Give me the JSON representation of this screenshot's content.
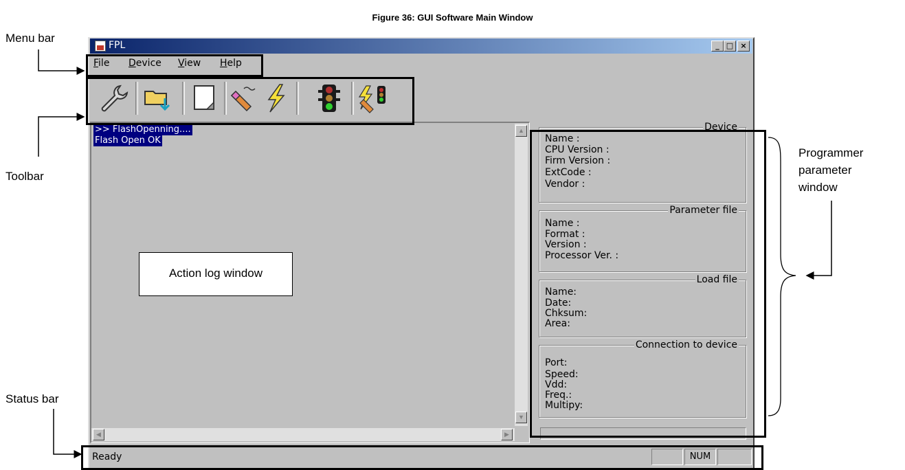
{
  "caption": "Figure 36: GUI Software Main Window",
  "annotations": {
    "menu_bar": "Menu bar",
    "toolbar": "Toolbar",
    "status_bar": "Status bar",
    "programmer_1": "Programmer",
    "programmer_2": "parameter",
    "programmer_3": "window",
    "action_log": "Action log window"
  },
  "window": {
    "title": "FPL",
    "minimize": "_",
    "maximize": "□",
    "close": "×"
  },
  "menu": [
    {
      "label_u": "F",
      "label_rest": "ile"
    },
    {
      "label_u": "D",
      "label_rest": "evice"
    },
    {
      "label_u": "V",
      "label_rest": "iew"
    },
    {
      "label_u": "H",
      "label_rest": "elp"
    }
  ],
  "toolbar": {
    "icons": [
      "wrench-icon",
      "folder-load-icon",
      "blank-file-icon",
      "erase-icon",
      "lightning-icon",
      "traffic-light-icon",
      "autoprocedure-icon"
    ]
  },
  "log": {
    "lines": [
      ">> FlashOpenning....",
      "Flash Open OK"
    ]
  },
  "groups": {
    "device": {
      "title": "Device",
      "fields": [
        "Name :",
        "CPU Version :",
        "Firm Version :",
        "ExtCode :",
        "Vendor :"
      ]
    },
    "parameter_file": {
      "title": "Parameter file",
      "fields": [
        "Name :",
        "Format :",
        "Version :",
        "Processor Ver. :"
      ]
    },
    "load_file": {
      "title": "Load file",
      "fields": [
        "Name:",
        "Date:",
        "Chksum:",
        "Area:"
      ]
    },
    "connection": {
      "title": "Connection to device",
      "fields": [
        "Port:",
        "Speed:",
        "Vdd:",
        "Freq.:",
        "Multipy:"
      ]
    }
  },
  "status": {
    "text": "Ready",
    "num": "NUM"
  },
  "colors": {
    "title_start": "#0a246a",
    "title_end": "#a6caf0",
    "face": "#c0c0c0",
    "selection": "#000080"
  }
}
